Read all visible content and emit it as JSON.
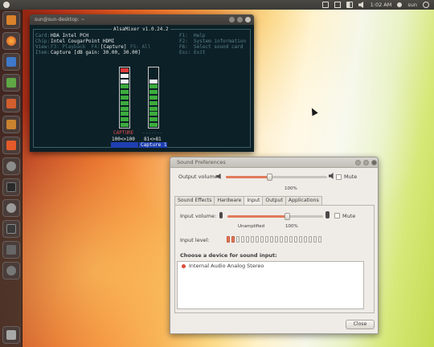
{
  "top_panel": {
    "time": "1:02 AM",
    "user": "sun"
  },
  "alsamixer": {
    "window_title": "AlsaMixer v1.0.24.2",
    "terminal_title": "sun@sun-desktop: ~",
    "card_label": "Card:",
    "card_value": "HDA Intel PCH",
    "chip_label": "Chip:",
    "chip_value": "Intel CougarPoint HDMI",
    "view_label": "View:",
    "view_options_left": "F3: Playback  F4:",
    "view_selected": "[Capture]",
    "view_options_right": "F5: All",
    "item_label": "Item:",
    "item_value": "Capture [dB gain: 30.00, 30.00]",
    "keys": [
      "F1:  Help",
      "F2:  System information",
      "F6:  Select sound card",
      "Esc: Exit"
    ],
    "capture_flag": "CAPTURE",
    "capture_value": "100<>100",
    "capture1_dots": "-------",
    "capture1_value": "81<>81",
    "capture1_name": "Capture 1",
    "capture_level": 1.0,
    "capture1_level": 0.81
  },
  "sound_prefs": {
    "window_title": "Sound Preferences",
    "output_volume_label": "Output volume:",
    "output_volume_level": 0.43,
    "output_mute_label": "Mute",
    "output_100_label": "100%",
    "tabs": [
      "Sound Effects",
      "Hardware",
      "Input",
      "Output",
      "Applications"
    ],
    "active_tab": "Input",
    "input_volume_label": "Input volume:",
    "input_volume_level": 0.62,
    "input_mute_label": "Mute",
    "unamplified_label": "Unamplified",
    "input_100_label": "100%",
    "input_level_label": "Input level:",
    "input_level_lit": 2,
    "input_level_total": 20,
    "choose_device_label": "Choose a device for sound input:",
    "devices": [
      "Internal Audio Analog Stereo"
    ],
    "close_button": "Close"
  },
  "colors": {
    "accent": "#e07a5a",
    "launcher": "#322826",
    "terminal_bg": "#0c2027"
  }
}
